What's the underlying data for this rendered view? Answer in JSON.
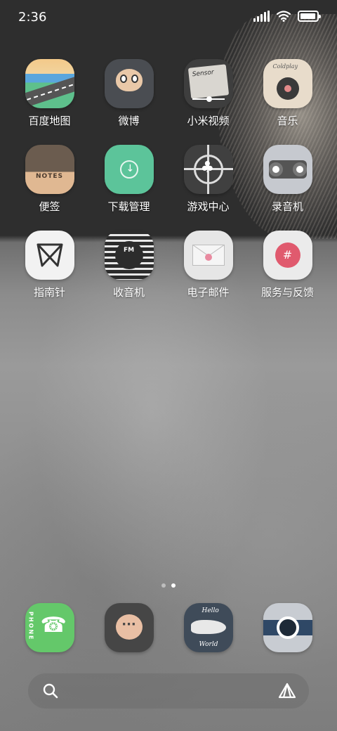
{
  "status_bar": {
    "time": "2:36",
    "battery_level": 0.95,
    "icons": [
      "signal-icon",
      "wifi-icon",
      "battery-icon"
    ]
  },
  "apps": [
    {
      "label": "百度地图",
      "icon": "baidu-map-icon"
    },
    {
      "label": "微博",
      "icon": "weibo-icon"
    },
    {
      "label": "小米视频",
      "icon": "mi-video-icon",
      "icon_text": "Sensor"
    },
    {
      "label": "音乐",
      "icon": "music-icon",
      "icon_text": "Coldplay"
    },
    {
      "label": "便签",
      "icon": "notes-icon",
      "icon_text": "NOTES"
    },
    {
      "label": "下载管理",
      "icon": "download-icon"
    },
    {
      "label": "游戏中心",
      "icon": "game-center-icon"
    },
    {
      "label": "录音机",
      "icon": "recorder-icon"
    },
    {
      "label": "指南针",
      "icon": "compass-icon"
    },
    {
      "label": "收音机",
      "icon": "radio-icon",
      "icon_text": "FM"
    },
    {
      "label": "电子邮件",
      "icon": "email-icon"
    },
    {
      "label": "服务与反馈",
      "icon": "feedback-icon",
      "icon_text": "#"
    }
  ],
  "page_indicator": {
    "pages": 2,
    "current": 2
  },
  "dock": [
    {
      "icon": "phone-icon",
      "icon_text": "PHONE"
    },
    {
      "icon": "messages-icon"
    },
    {
      "icon": "browser-icon",
      "icon_text_top": "Hello",
      "icon_text_bottom": "World"
    },
    {
      "icon": "camera-icon"
    }
  ],
  "search": {
    "placeholder": ""
  },
  "colors": {
    "dock_phone": "#64c86a",
    "feedback_accent": "#e05a6e",
    "download": "#5cc49a"
  }
}
